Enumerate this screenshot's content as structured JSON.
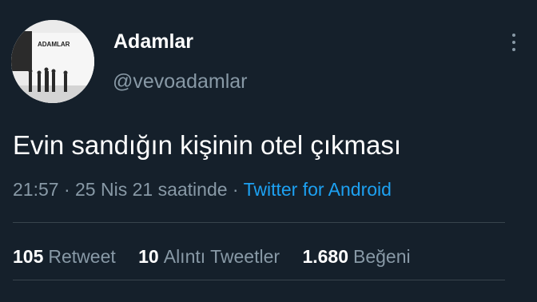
{
  "author": {
    "name": "Adamlar",
    "handle": "@vevoadamlar",
    "avatar_text": "ADAMLAR"
  },
  "tweet": {
    "text": "Evin sandığın kişinin otel çıkması",
    "time": "21:57",
    "date_text": "25 Nis 21 saatinde",
    "separator": "·",
    "source": "Twitter for Android"
  },
  "stats": [
    {
      "count": "105",
      "label": "Retweet"
    },
    {
      "count": "10",
      "label": "Alıntı Tweetler"
    },
    {
      "count": "1.680",
      "label": "Beğeni"
    }
  ],
  "colors": {
    "background": "#15202b",
    "text": "#ffffff",
    "muted": "#8899a6",
    "link": "#1da1f2",
    "divider": "#38444d"
  },
  "icons": {
    "more": "more-vertical-icon"
  }
}
